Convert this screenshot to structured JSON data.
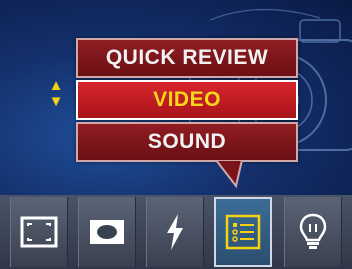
{
  "menu": {
    "items": [
      {
        "label": "QUICK REVIEW",
        "selected": false
      },
      {
        "label": "VIDEO",
        "selected": true
      },
      {
        "label": "SOUND",
        "selected": false
      }
    ],
    "scroll_indicator": {
      "up_glyph": "▲",
      "down_glyph": "▼"
    }
  },
  "toolbar": {
    "items": [
      {
        "icon": "frame-icon",
        "selected": false
      },
      {
        "icon": "camera-eye-icon",
        "selected": false
      },
      {
        "icon": "flash-icon",
        "selected": false
      },
      {
        "icon": "menu-list-icon",
        "selected": true
      },
      {
        "icon": "lightbulb-icon",
        "selected": false
      }
    ]
  },
  "colors": {
    "background": "#14306c",
    "menu_item": "#7a141a",
    "menu_item_selected": "#c41c22",
    "selected_text": "#f7d61c",
    "text": "#f2f2f2",
    "toolbar": "#3e4657",
    "toolbar_selected": "#33628a"
  }
}
